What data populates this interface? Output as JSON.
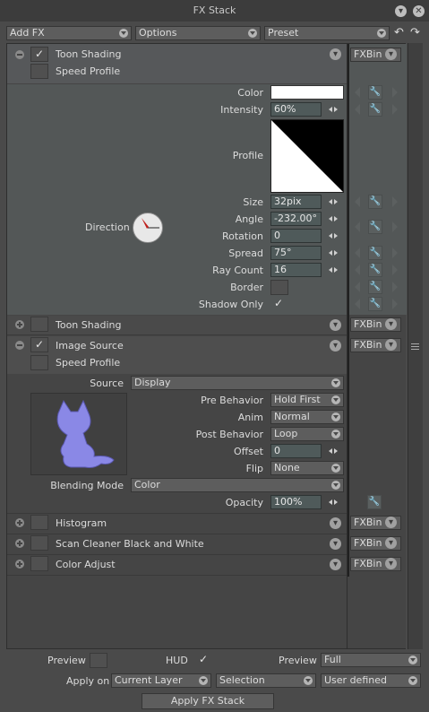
{
  "window": {
    "title": "FX Stack"
  },
  "toolbar": {
    "add_fx": "Add FX",
    "options": "Options",
    "preset": "Preset"
  },
  "fx": [
    {
      "name": "Toon Shading",
      "expanded": true,
      "checked": true,
      "subtitle": "Speed Profile",
      "fxbin": "FXBin",
      "params": {
        "color_label": "Color",
        "color_value": "#ffffff",
        "intensity_label": "Intensity",
        "intensity": "60%",
        "profile_label": "Profile",
        "size_label": "Size",
        "size": "32pix",
        "angle_label": "Angle",
        "angle": "-232.00°",
        "rotation_label": "Rotation",
        "rotation": "0",
        "spread_label": "Spread",
        "spread": "75°",
        "raycount_label": "Ray Count",
        "raycount": "16",
        "border_label": "Border",
        "shadowonly_label": "Shadow Only",
        "shadowonly_check": "✓",
        "direction_label": "Direction"
      }
    },
    {
      "name": "Toon Shading",
      "expanded": false,
      "fxbin": "FXBin"
    },
    {
      "name": "Image Source",
      "expanded": true,
      "checked": true,
      "subtitle": "Speed Profile",
      "fxbin": "FXBin",
      "params": {
        "source_label": "Source",
        "source": "Display",
        "prebehavior_label": "Pre Behavior",
        "prebehavior": "Hold First",
        "anim_label": "Anim",
        "anim": "Normal",
        "postbehavior_label": "Post Behavior",
        "postbehavior": "Loop",
        "offset_label": "Offset",
        "offset": "0",
        "flip_label": "Flip",
        "flip": "None",
        "blending_label": "Blending Mode",
        "blending": "Color",
        "opacity_label": "Opacity",
        "opacity": "100%"
      }
    },
    {
      "name": "Histogram",
      "expanded": false,
      "fxbin": "FXBin"
    },
    {
      "name": "Scan Cleaner Black and White",
      "expanded": false,
      "fxbin": "FXBin"
    },
    {
      "name": "Color Adjust",
      "expanded": false,
      "fxbin": "FXBin"
    }
  ],
  "footer": {
    "preview_label": "Preview",
    "hud_label": "HUD",
    "hud_check": "✓",
    "preview2_label": "Preview",
    "preview_mode": "Full",
    "apply_on_label": "Apply on",
    "apply_on": "Current Layer",
    "selection": "Selection",
    "user_defined": "User defined",
    "apply_button": "Apply FX Stack"
  },
  "colors": {
    "accent_red": "#c0201c",
    "image_source_tint": "#8a88e6"
  }
}
